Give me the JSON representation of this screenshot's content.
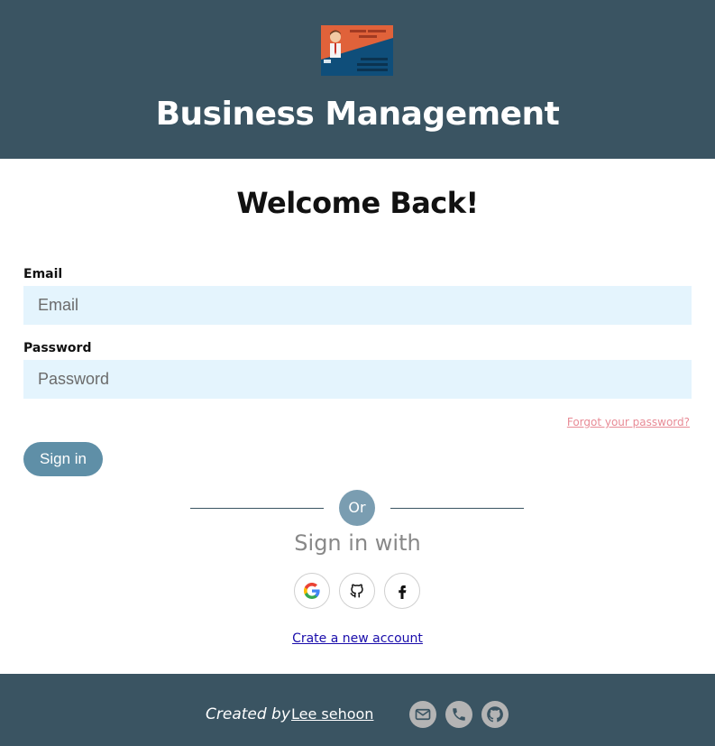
{
  "header": {
    "title": "Business Management",
    "logo_icon": "business-card-icon"
  },
  "main": {
    "heading": "Welcome Back!",
    "email": {
      "label": "Email",
      "placeholder": "Email",
      "value": ""
    },
    "password": {
      "label": "Password",
      "placeholder": "Password",
      "value": ""
    },
    "forgot_label": "Forgot your password?",
    "signin_label": "Sign in",
    "or_label": "Or",
    "signin_with_label": "Sign in with",
    "social": [
      {
        "icon": "google-icon"
      },
      {
        "icon": "github-icon"
      },
      {
        "icon": "facebook-icon"
      }
    ],
    "create_account_label": "Crate a new account"
  },
  "footer": {
    "created_by_label": "Created by",
    "author": "Lee sehoon",
    "icons": [
      "mail-icon",
      "phone-icon",
      "github-icon"
    ]
  },
  "colors": {
    "header_bg": "#3a5462",
    "input_bg": "#e4f4fd",
    "button_bg": "#5f8fa7",
    "or_badge_bg": "#7a9db1",
    "forgot_link": "#e88b96",
    "footer_icon_bg": "#b4b4b4"
  }
}
